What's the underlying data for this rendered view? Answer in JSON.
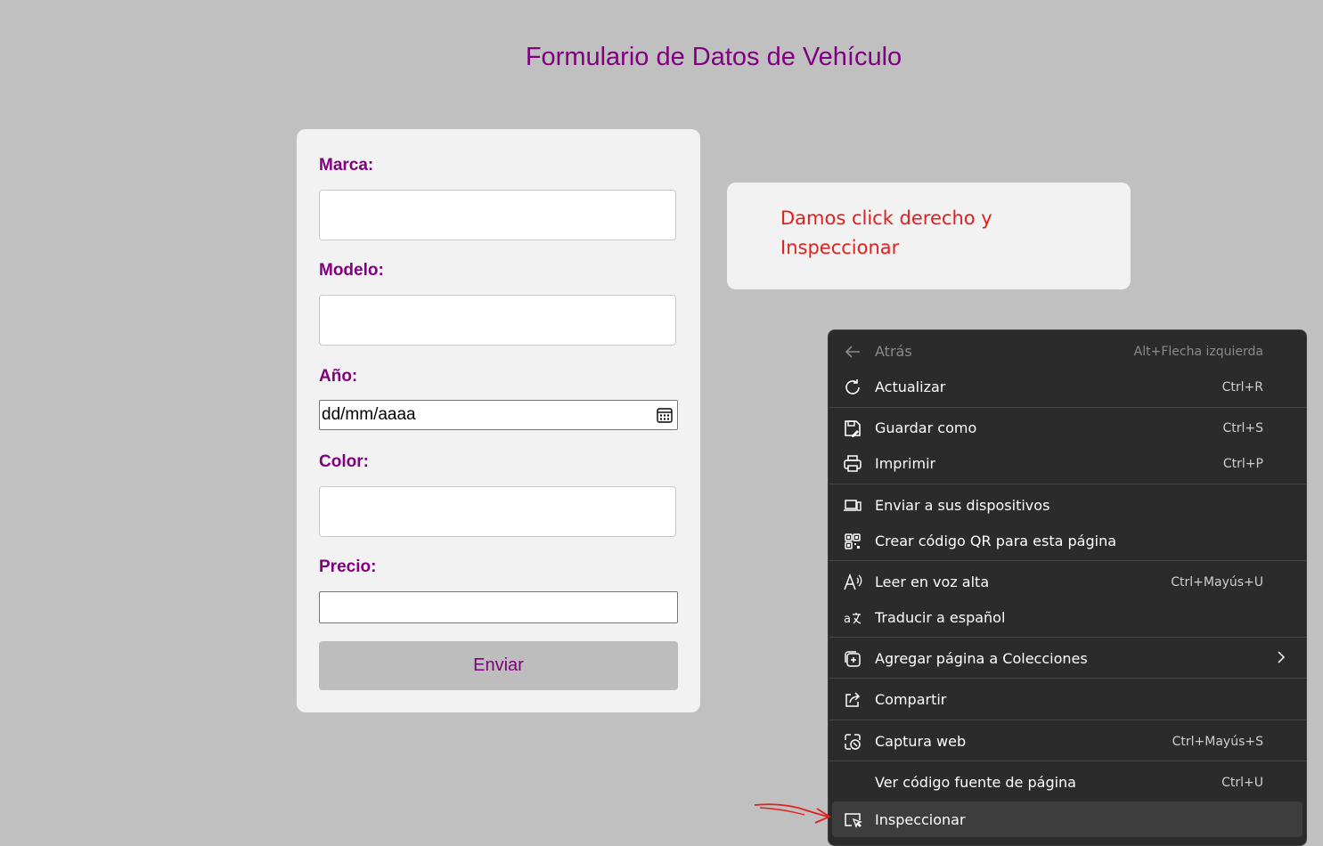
{
  "page": {
    "title": "Formulario de Datos de Vehículo"
  },
  "form": {
    "marca_label": "Marca:",
    "marca_value": "",
    "modelo_label": "Modelo:",
    "modelo_value": "",
    "anio_label": "Año:",
    "anio_placeholder": "dd/mm/aaaa",
    "color_label": "Color:",
    "color_value": "",
    "precio_label": "Precio:",
    "precio_value": "",
    "submit_label": "Enviar"
  },
  "note": {
    "text": "Damos click derecho y Inspeccionar"
  },
  "context_menu": {
    "items": [
      {
        "label": "Atrás",
        "shortcut": "Alt+Flecha izquierda",
        "icon": "back-arrow-icon",
        "disabled": true
      },
      {
        "label": "Actualizar",
        "shortcut": "Ctrl+R",
        "icon": "refresh-icon"
      },
      {
        "label": "Guardar como",
        "shortcut": "Ctrl+S",
        "icon": "save-icon"
      },
      {
        "label": "Imprimir",
        "shortcut": "Ctrl+P",
        "icon": "print-icon"
      },
      {
        "label": "Enviar a sus dispositivos",
        "shortcut": "",
        "icon": "devices-icon"
      },
      {
        "label": "Crear código QR para esta página",
        "shortcut": "",
        "icon": "qr-code-icon"
      },
      {
        "label": "Leer en voz alta",
        "shortcut": "Ctrl+Mayús+U",
        "icon": "read-aloud-icon"
      },
      {
        "label": "Traducir a español",
        "shortcut": "",
        "icon": "translate-icon"
      },
      {
        "label": "Agregar página a Colecciones",
        "shortcut": "",
        "icon": "collections-icon"
      },
      {
        "label": "Compartir",
        "shortcut": "",
        "icon": "share-icon"
      },
      {
        "label": "Captura web",
        "shortcut": "Ctrl+Mayús+S",
        "icon": "web-capture-icon"
      },
      {
        "label": "Ver código fuente de página",
        "shortcut": "Ctrl+U",
        "icon": ""
      },
      {
        "label": "Inspeccionar",
        "shortcut": "",
        "icon": "inspect-icon"
      }
    ]
  },
  "colors": {
    "page_bg": "#c0c0c0",
    "accent_purple": "#800080",
    "note_red": "#e01f1f",
    "menu_bg": "#2b2b2b"
  }
}
